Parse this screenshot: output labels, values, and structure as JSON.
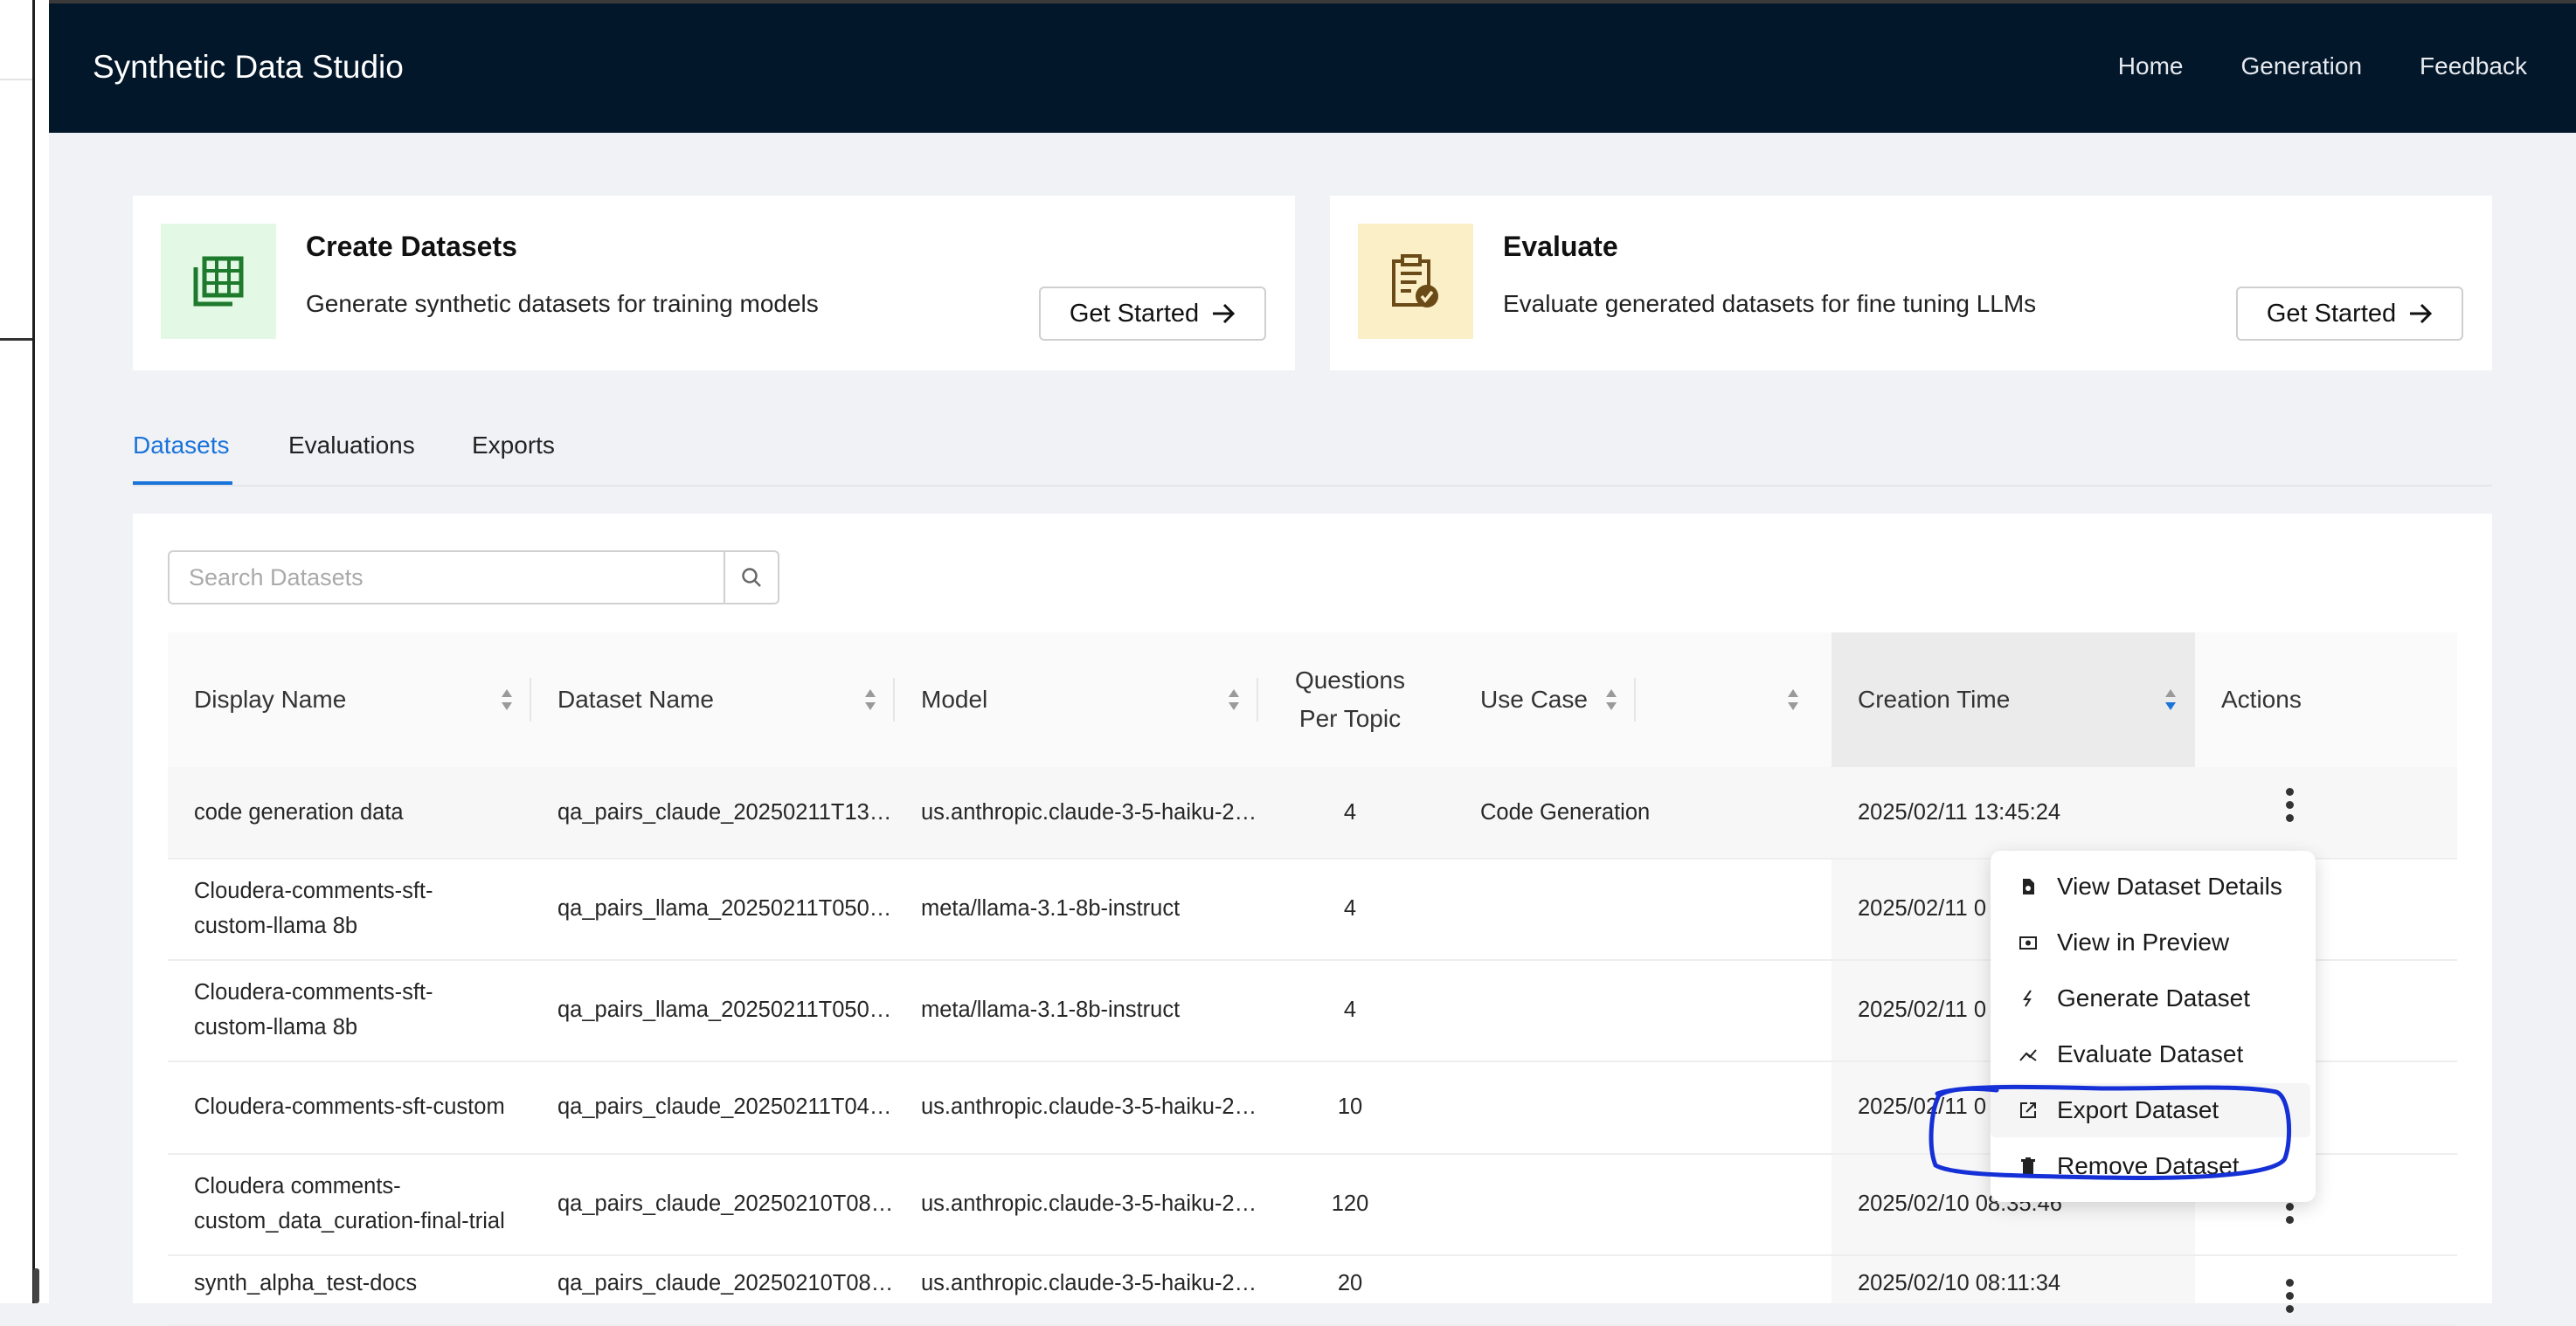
{
  "app": {
    "title": "Synthetic Data Studio"
  },
  "nav": {
    "home": "Home",
    "generation": "Generation",
    "feedback": "Feedback"
  },
  "cards": [
    {
      "title": "Create Datasets",
      "description": "Generate synthetic datasets for training models",
      "button": "Get Started",
      "icon": "spreadsheet-icon",
      "icon_bg": "#e3f9e5",
      "icon_color": "#1e7a2c"
    },
    {
      "title": "Evaluate",
      "description": "Evaluate generated datasets for fine tuning LLMs",
      "button": "Get Started",
      "icon": "clipboard-check-icon",
      "icon_bg": "#fbefc8",
      "icon_color": "#6a4a17"
    }
  ],
  "tabs": {
    "datasets": "Datasets",
    "evaluations": "Evaluations",
    "exports": "Exports",
    "active": "Datasets"
  },
  "search": {
    "placeholder": "Search Datasets"
  },
  "table": {
    "columns": {
      "display_name": "Display Name",
      "dataset_name": "Dataset Name",
      "model": "Model",
      "qpt_1": "Questions",
      "qpt_2": "Per Topic",
      "use_case": "Use Case",
      "creation_time": "Creation Time",
      "actions": "Actions"
    },
    "sorted_column": "Creation Time",
    "rows": [
      {
        "display_name": "code generation data",
        "dataset_name": "qa_pairs_claude_20250211T13…",
        "model": "us.anthropic.claude-3-5-haiku-2…",
        "qpt": "4",
        "use_case": "Code Generation",
        "creation_time": "2025/02/11 13:45:24"
      },
      {
        "display_name": "Cloudera-comments-sft-custom-llama 8b",
        "dataset_name": "qa_pairs_llama_20250211T050…",
        "model": "meta/llama-3.1-8b-instruct",
        "qpt": "4",
        "use_case": "",
        "creation_time": "2025/02/11 0"
      },
      {
        "display_name": "Cloudera-comments-sft-custom-llama 8b",
        "dataset_name": "qa_pairs_llama_20250211T050…",
        "model": "meta/llama-3.1-8b-instruct",
        "qpt": "4",
        "use_case": "",
        "creation_time": "2025/02/11 0"
      },
      {
        "display_name": "Cloudera-comments-sft-custom",
        "dataset_name": "qa_pairs_claude_20250211T04…",
        "model": "us.anthropic.claude-3-5-haiku-2…",
        "qpt": "10",
        "use_case": "",
        "creation_time": "2025/02/11 0"
      },
      {
        "display_name": "Cloudera comments-custom_data_curation-final-trial",
        "dataset_name": "qa_pairs_claude_20250210T08…",
        "model": "us.anthropic.claude-3-5-haiku-2…",
        "qpt": "120",
        "use_case": "",
        "creation_time": "2025/02/10 08:35:46"
      },
      {
        "display_name": "synth_alpha_test-docs",
        "dataset_name": "qa_pairs_claude_20250210T08…",
        "model": "us.anthropic.claude-3-5-haiku-2…",
        "qpt": "20",
        "use_case": "",
        "creation_time": "2025/02/10 08:11:34"
      }
    ]
  },
  "actions_menu": {
    "items": [
      {
        "label": "View Dataset Details",
        "icon": "file-details-icon"
      },
      {
        "label": "View in Preview",
        "icon": "preview-icon"
      },
      {
        "label": "Generate Dataset",
        "icon": "lightning-icon"
      },
      {
        "label": "Evaluate Dataset",
        "icon": "evaluate-icon"
      },
      {
        "label": "Export Dataset",
        "icon": "export-icon"
      },
      {
        "label": "Remove Dataset",
        "icon": "trash-icon"
      }
    ],
    "highlighted": "Export Dataset"
  },
  "colors": {
    "header_bg": "#03172b",
    "accent": "#1a73d9",
    "annotation": "#1530d6"
  }
}
